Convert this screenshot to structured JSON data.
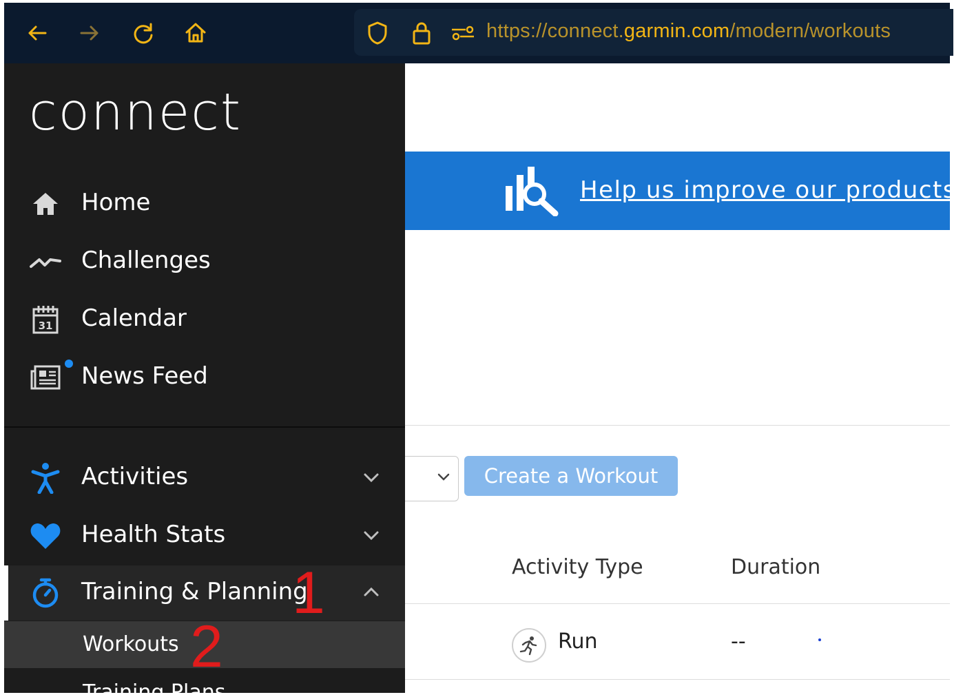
{
  "browser": {
    "url_prefix": "https://connect.",
    "url_domain": "garmin.com",
    "url_path": "/modern/workouts",
    "icons": [
      "back-arrow-icon",
      "forward-arrow-icon",
      "reload-icon",
      "home-icon",
      "shield-icon",
      "lock-icon",
      "permissions-icon"
    ]
  },
  "sidebar": {
    "logo": "connect",
    "items": [
      {
        "label": "Home",
        "icon": "home-icon"
      },
      {
        "label": "Challenges",
        "icon": "challenges-icon"
      },
      {
        "label": "Calendar",
        "icon": "calendar-icon",
        "icon_text": "31"
      },
      {
        "label": "News Feed",
        "icon": "news-icon",
        "has_notification_dot": true
      }
    ],
    "groups": [
      {
        "label": "Activities",
        "icon": "activities-icon",
        "expanded": false
      },
      {
        "label": "Health Stats",
        "icon": "heart-icon",
        "expanded": false
      },
      {
        "label": "Training & Planning",
        "icon": "stopwatch-icon",
        "expanded": true
      }
    ],
    "subitems": [
      {
        "label": "Workouts",
        "active": true
      },
      {
        "label": "Training Plans",
        "active": false
      }
    ]
  },
  "main": {
    "banner_text": "Help us improve our products a",
    "create_button": "Create a Workout",
    "columns": [
      "Activity Type",
      "Duration"
    ],
    "rows": [
      {
        "activity_type": "Run",
        "duration": "--"
      }
    ]
  },
  "annotations": [
    "1",
    "2"
  ],
  "colors": {
    "accent": "#1a76d2",
    "sidebar_bg": "#1c1c1c",
    "icon_blue": "#1d8cf2",
    "annotation_red": "#e01c1c"
  }
}
